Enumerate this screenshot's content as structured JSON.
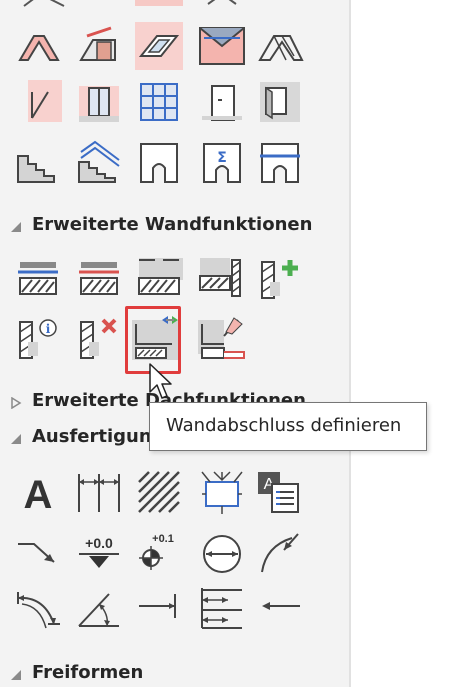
{
  "sections": {
    "extended_wall": "Erweiterte Wandfunktionen",
    "extended_other": "Erweiterte Dachfunktionen",
    "finishing": "Ausfertigung",
    "freeforms": "Freiformen"
  },
  "tooltip": {
    "text": "Wandabschluss definieren"
  },
  "icons": {
    "row1": [
      "roof-icon",
      "roof-dormer-icon",
      "skylight-icon",
      "roof-window-icon",
      "truss-icon"
    ],
    "row2": [
      "stair-rail-icon",
      "window-icon",
      "grid-window-icon",
      "door-icon",
      "wall-opening-icon"
    ],
    "row3": [
      "stairs-icon",
      "stairs-railing-icon",
      "arch-opening-icon",
      "sum-opening-icon",
      "lintel-opening-icon"
    ],
    "wall_row1": [
      "wall-layer-top-icon",
      "wall-layer-red-icon",
      "wall-slab-icon",
      "wall-corner-icon",
      "wall-add-icon"
    ],
    "wall_row2": [
      "wall-info-icon",
      "wall-delete-icon",
      "wall-end-define-icon",
      "wall-end-edit-icon"
    ],
    "fin_row1": [
      "text-icon",
      "dimension-icon",
      "hatch-icon",
      "symbol-box-icon",
      "text-label-icon"
    ],
    "fin_row2": [
      "leader-icon",
      "level-marker-icon",
      "elevation-point-icon",
      "circle-dimension-icon",
      "angle-arrow-icon"
    ],
    "fin_row3": [
      "arc-dimension-icon",
      "angle-dimension-icon",
      "line-arrow-icon",
      "vertical-dimension-icon",
      "arrow-left-icon"
    ]
  }
}
